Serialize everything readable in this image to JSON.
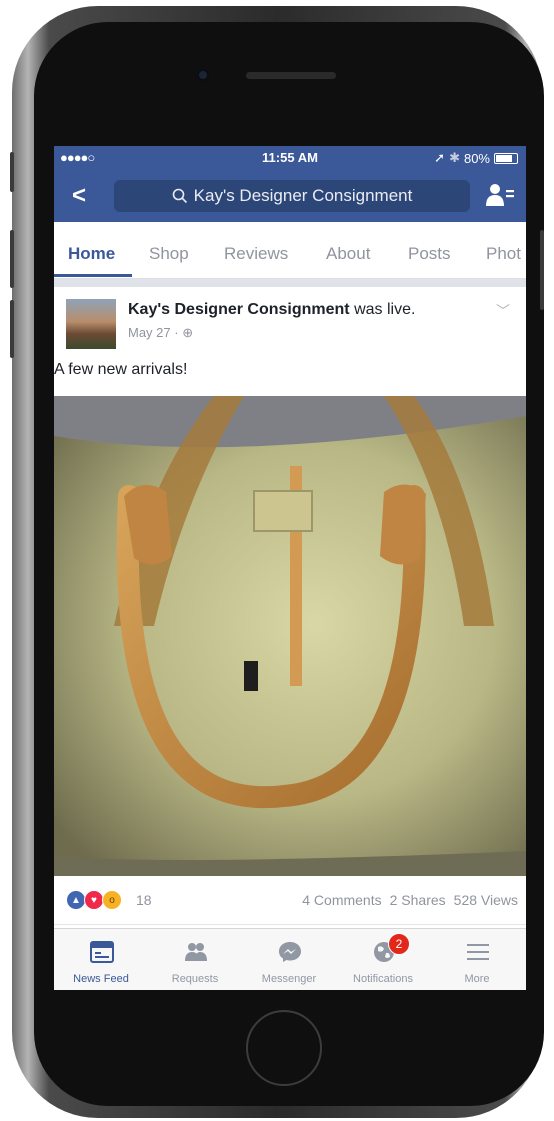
{
  "status_bar": {
    "signal": "●●●●○",
    "time": "11:55 AM",
    "battery": "80%"
  },
  "nav": {
    "back_label": "<",
    "search_text": "Kay's Designer Consignment"
  },
  "tabs": [
    {
      "label": "Home"
    },
    {
      "label": "Shop"
    },
    {
      "label": "Reviews"
    },
    {
      "label": "About"
    },
    {
      "label": "Posts"
    },
    {
      "label": "Phot"
    }
  ],
  "post": {
    "page_name": "Kay's Designer Consignment",
    "action": " was live.",
    "date": "May 27 · ",
    "text": "A few new arrivals!"
  },
  "reactions": {
    "count": "18",
    "comments": "4 Comments",
    "shares": "2 Shares",
    "views": "528 Views"
  },
  "tab_bar": {
    "items": [
      {
        "label": "News Feed"
      },
      {
        "label": "Requests"
      },
      {
        "label": "Messenger"
      },
      {
        "label": "Notifications",
        "badge": "2"
      },
      {
        "label": "More"
      }
    ]
  },
  "colors": {
    "brand": "#3b5998",
    "badge": "#e3281b"
  }
}
